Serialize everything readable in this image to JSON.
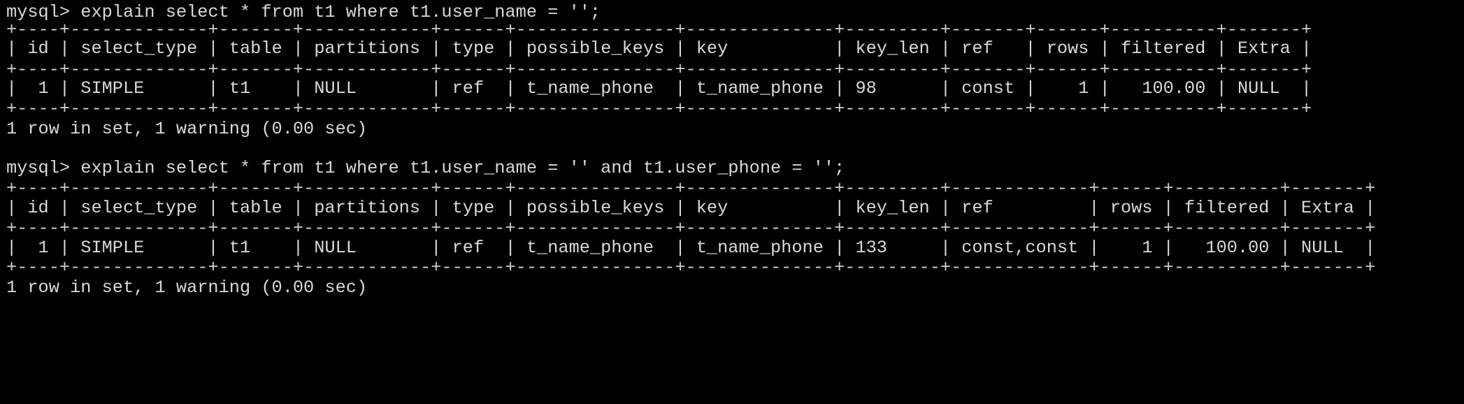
{
  "terminal": {
    "background": "#000000",
    "foreground": "#d9d9d9",
    "lines": [
      "mysql> explain select * from t1 where t1.user_name = '';",
      "+----+-------------+-------+------------+------+---------------+--------------+---------+-------+------+----------+-------+",
      "| id | select_type | table | partitions | type | possible_keys | key          | key_len | ref   | rows | filtered | Extra |",
      "+----+-------------+-------+------------+------+---------------+--------------+---------+-------+------+----------+-------+",
      "|  1 | SIMPLE      | t1    | NULL       | ref  | t_name_phone  | t_name_phone | 98      | const |    1 |   100.00 | NULL  |",
      "+----+-------------+-------+------------+------+---------------+--------------+---------+-------+------+----------+-------+",
      "1 row in set, 1 warning (0.00 sec)",
      "",
      "mysql> explain select * from t1 where t1.user_name = '' and t1.user_phone = '';",
      "+----+-------------+-------+------------+------+---------------+--------------+---------+-------------+------+----------+-------+",
      "| id | select_type | table | partitions | type | possible_keys | key          | key_len | ref         | rows | filtered | Extra |",
      "+----+-------------+-------+------------+------+---------------+--------------+---------+-------------+------+----------+-------+",
      "|  1 | SIMPLE      | t1    | NULL       | ref  | t_name_phone  | t_name_phone | 133     | const,const |    1 |   100.00 | NULL  |",
      "+----+-------------+-------+------------+------+---------------+--------------+---------+-------------+------+----------+-------+",
      "1 row in set, 1 warning (0.00 sec)"
    ]
  }
}
